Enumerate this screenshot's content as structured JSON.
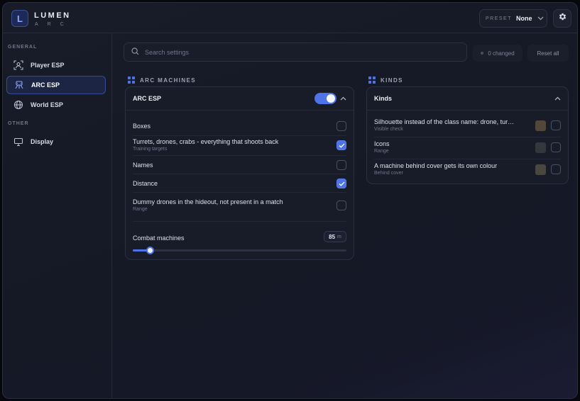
{
  "brand": {
    "name": "LUMEN",
    "sub": "ARC",
    "logo_letter": "L"
  },
  "header": {
    "preset_label": "PRESET",
    "preset_value": "None"
  },
  "sidebar": {
    "section_general": "GENERAL",
    "section_other": "OTHER",
    "items": [
      {
        "label": "Player ESP",
        "icon": "player-scan-icon"
      },
      {
        "label": "ARC ESP",
        "icon": "arc-machine-icon",
        "active": true
      },
      {
        "label": "World ESP",
        "icon": "globe-icon"
      },
      {
        "label": "Display",
        "icon": "monitor-icon"
      }
    ]
  },
  "toolbar": {
    "search_placeholder": "Search settings",
    "changed_label": "0 changed",
    "reset_label": "Reset all"
  },
  "arc_machines": {
    "section_title": "ARC MACHINES",
    "card_title": "ARC ESP",
    "enabled": true,
    "rows": [
      {
        "label": "Boxes",
        "sub": "",
        "checked": false
      },
      {
        "label": "Turrets, drones, crabs - everything that shoots back",
        "sub": "Training targets",
        "checked": true
      },
      {
        "label": "Names",
        "sub": "",
        "checked": false
      },
      {
        "label": "Distance",
        "sub": "",
        "checked": true
      },
      {
        "label": "Dummy drones in the hideout, not present in a match",
        "sub": "Range",
        "checked": false
      }
    ],
    "slider": {
      "label": "Combat machines",
      "value": "85",
      "unit": "m",
      "fraction": 0.08
    }
  },
  "kinds": {
    "section_title": "KINDS",
    "card_title": "Kinds",
    "rows": [
      {
        "label": "Silhouette instead of the class name: drone, tur…",
        "sub": "Visible check",
        "swatch": "#51483a",
        "checked": false
      },
      {
        "label": "Icons",
        "sub": "Range",
        "swatch": "#34373c",
        "checked": false
      },
      {
        "label": "A machine behind cover gets its own colour",
        "sub": "Behind cover",
        "swatch": "#49473f",
        "checked": false
      }
    ]
  },
  "colors": {
    "accent": "#4e72e8"
  }
}
